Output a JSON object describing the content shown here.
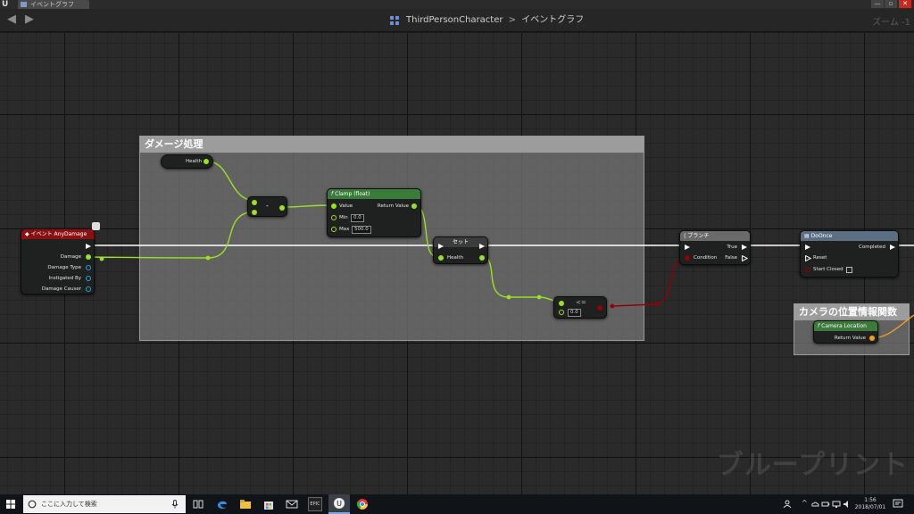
{
  "window": {
    "tab_label": "イベントグラフ",
    "controls": [
      "—",
      "▫",
      "✕"
    ]
  },
  "header": {
    "breadcrumb_root": "ThirdPersonCharacter",
    "breadcrumb_sep": ">",
    "breadcrumb_current": "イベントグラフ",
    "zoom": "ズーム -1",
    "back_glyph": "◀",
    "forward_glyph": "▶"
  },
  "comments": [
    {
      "title": "ダメージ処理"
    },
    {
      "title": "カメラの位置情報関数"
    }
  ],
  "nodes": {
    "event_any_damage": {
      "title": "イベント AnyDamage",
      "header_color": "#8b1111",
      "pins": [
        "Damage",
        "Damage Type",
        "Instigated By",
        "Damage Causer"
      ]
    },
    "get_health": {
      "label": "Health"
    },
    "subtract": {
      "label": "-"
    },
    "clamp": {
      "title": "Clamp (float)",
      "header_color": "#3a7a3a",
      "pin_value": "Value",
      "pin_min": "Min",
      "min_value": "0.0",
      "pin_max": "Max",
      "max_value": "500.0",
      "pin_return": "Return Value"
    },
    "set_health": {
      "title": "セット",
      "pin_health": "Health"
    },
    "less_equal": {
      "op": "<=",
      "value": "0.0"
    },
    "branch": {
      "title": "ブランチ",
      "header_color": "#6a6a6a",
      "pin_condition": "Condition",
      "pin_true": "True",
      "pin_false": "False"
    },
    "do_once": {
      "title": "DoOnce",
      "header_color": "#5b6e84",
      "pin_completed": "Completed",
      "pin_reset": "Reset",
      "pin_start_closed": "Start Closed"
    },
    "camera_location": {
      "title": "Camera Location",
      "header_color": "#3a7a3a",
      "pin_return": "Return Value"
    }
  },
  "colors": {
    "float_wire": "#9ae023",
    "exec_wire": "#ffffff",
    "bool_wire": "#930000",
    "vector_wire": "#f0a020",
    "object_pin": "#1aa6e8"
  },
  "watermark": "ブループリント",
  "taskbar": {
    "search_placeholder": "ここに入力して検索",
    "epic_label": "EPIC",
    "clock_time": "1:56",
    "clock_date": "2018/07/01"
  }
}
